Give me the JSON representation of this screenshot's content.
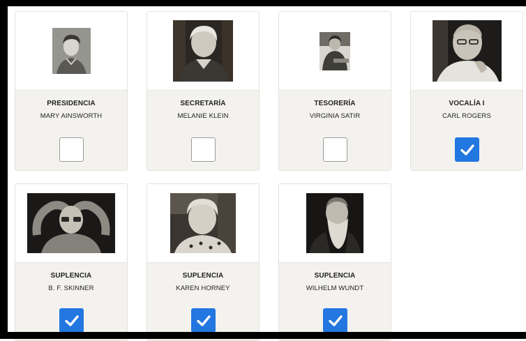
{
  "board": [
    {
      "role": "PRESIDENCIA",
      "name": "MARY AINSWORTH",
      "checked": false,
      "photo": "portrait-woman-short-hair"
    },
    {
      "role": "SECRETARÍA",
      "name": "MELANIE KLEIN",
      "checked": false,
      "photo": "portrait-elderly-woman"
    },
    {
      "role": "TESORERÍA",
      "name": "VIRGINIA SATIR",
      "checked": false,
      "photo": "portrait-woman-seated"
    },
    {
      "role": "VOCALÍA I",
      "name": "CARL ROGERS",
      "checked": true,
      "photo": "portrait-man-glasses"
    },
    {
      "role": "SUPLENCIA",
      "name": "B. F. SKINNER",
      "checked": true,
      "photo": "portrait-man-hands-on-head"
    },
    {
      "role": "SUPLENCIA",
      "name": "KAREN HORNEY",
      "checked": true,
      "photo": "portrait-woman-smiling"
    },
    {
      "role": "SUPLENCIA",
      "name": "WILHELM WUNDT",
      "checked": true,
      "photo": "portrait-bearded-man"
    }
  ],
  "colors": {
    "checkbox_checked": "#2277e0",
    "card_bg": "#f3f2ee"
  }
}
